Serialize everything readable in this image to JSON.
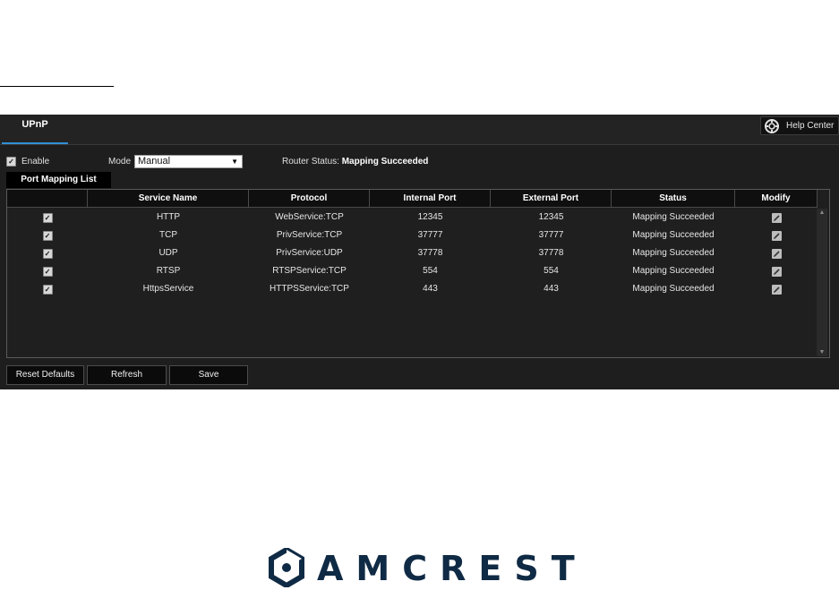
{
  "panel": {
    "tab_label": "UPnP",
    "help_label": "Help Center"
  },
  "controls": {
    "enable_label": "Enable",
    "enable_checked": true,
    "mode_label": "Mode",
    "mode_value": "Manual",
    "router_status_label": "Router Status:",
    "router_status_value": "Mapping Succeeded"
  },
  "list_tab": "Port Mapping List",
  "table": {
    "headers": [
      "",
      "Service Name",
      "Protocol",
      "Internal Port",
      "External Port",
      "Status",
      "Modify"
    ],
    "rows": [
      {
        "checked": true,
        "service": "HTTP",
        "protocol": "WebService:TCP",
        "internal": "12345",
        "external": "12345",
        "status": "Mapping Succeeded"
      },
      {
        "checked": true,
        "service": "TCP",
        "protocol": "PrivService:TCP",
        "internal": "37777",
        "external": "37777",
        "status": "Mapping Succeeded"
      },
      {
        "checked": true,
        "service": "UDP",
        "protocol": "PrivService:UDP",
        "internal": "37778",
        "external": "37778",
        "status": "Mapping Succeeded"
      },
      {
        "checked": true,
        "service": "RTSP",
        "protocol": "RTSPService:TCP",
        "internal": "554",
        "external": "554",
        "status": "Mapping Succeeded"
      },
      {
        "checked": true,
        "service": "HttpsService",
        "protocol": "HTTPSService:TCP",
        "internal": "443",
        "external": "443",
        "status": "Mapping Succeeded"
      }
    ]
  },
  "buttons": {
    "reset": "Reset Defaults",
    "refresh": "Refresh",
    "save": "Save"
  },
  "brand": {
    "logo_text": "AMCREST",
    "color": "#0f2a44"
  },
  "icons": {
    "help": "help-center-icon",
    "modify": "edit-pencil-icon",
    "check": "checkmark-icon",
    "dropdown": "triangle-down-icon"
  }
}
